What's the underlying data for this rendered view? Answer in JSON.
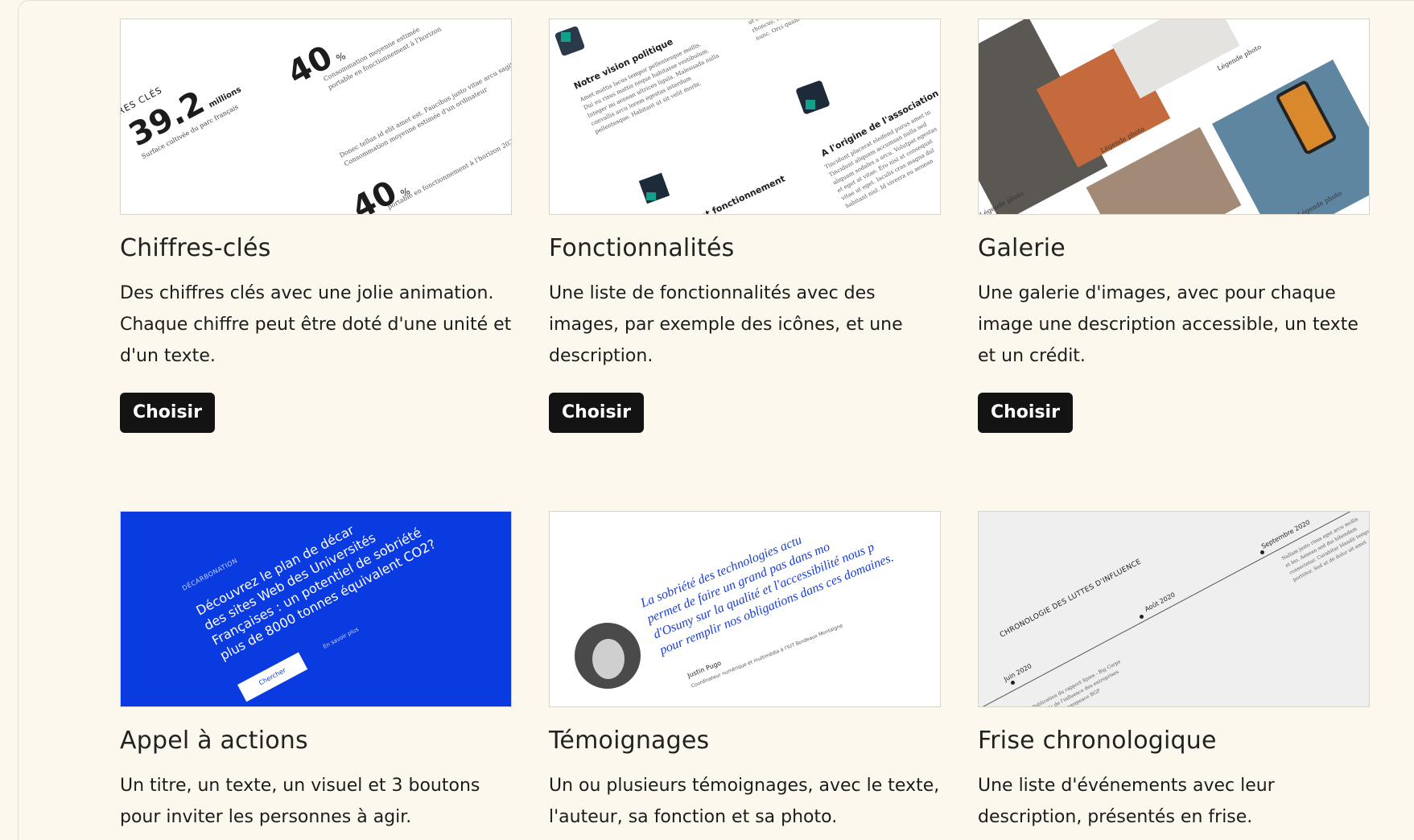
{
  "cards": [
    {
      "title": "Chiffres-clés",
      "description": "Des chiffres clés avec une jolie animation. Chaque chiffre peut être doté d'une unité et d'un texte.",
      "button": "Choisir",
      "thumb": {
        "heading": "RES CLÉS",
        "stat_main": "39.2",
        "stat_main_unit": "millions",
        "stat_a": "40",
        "stat_b": "40",
        "stat_unit": "%"
      }
    },
    {
      "title": "Fonctionnalités",
      "description": "Une liste de fonctionnalités avec des images, par exemple des icônes, et une description.",
      "button": "Choisir",
      "thumb": {
        "h1": "Notre vision politique",
        "h2": "A l'origine de l'association",
        "h3": "et fonctionnement"
      }
    },
    {
      "title": "Galerie",
      "description": "Une galerie d'images, avec pour chaque image une description accessible, un texte et un crédit.",
      "button": "Choisir",
      "thumb": {
        "caption1": "Légende photo",
        "caption2": "Légende photo",
        "caption3": "Légende photo",
        "caption4": "Légende photo"
      }
    },
    {
      "title": "Appel à actions",
      "description": "Un titre, un texte, un visuel et 3 boutons pour inviter les personnes à agir.",
      "thumb": {
        "kicker": "DÉCARBONATION",
        "headline_1": "Découvrez le plan de décar",
        "headline_2": "des sites Web des Universités",
        "headline_3": "Françaises : un potentiel de sobriété",
        "headline_4": "plus de 8000 tonnes équivalent CO2?",
        "button": "Chercher",
        "link": "En savoir plus"
      }
    },
    {
      "title": "Témoignages",
      "description": "Un ou plusieurs témoignages, avec le texte, l'auteur, sa fonction et sa photo.",
      "thumb": {
        "quote_1": "La sobriété des technologies actu",
        "quote_2": "permet de faire un grand pas dans mo",
        "quote_3": "d'Osuny sur la qualité et l'accessibilité nous p",
        "quote_4": "pour remplir nos obligations dans ces domaines.",
        "author": "Justin Pugo",
        "role": "Coordinateur numérique et multimédia à l'IUT Bordeaux Montaigne"
      }
    },
    {
      "title": "Frise chronologique",
      "description": "Une liste d'événements avec leur description, présentés en frise.",
      "thumb": {
        "heading": "CHRONOLOGIE DES LUTTES D'INFLUENCE",
        "date1": "Juin 2020",
        "date2": "Août 2020",
        "date3": "Septembre 2020"
      }
    }
  ]
}
